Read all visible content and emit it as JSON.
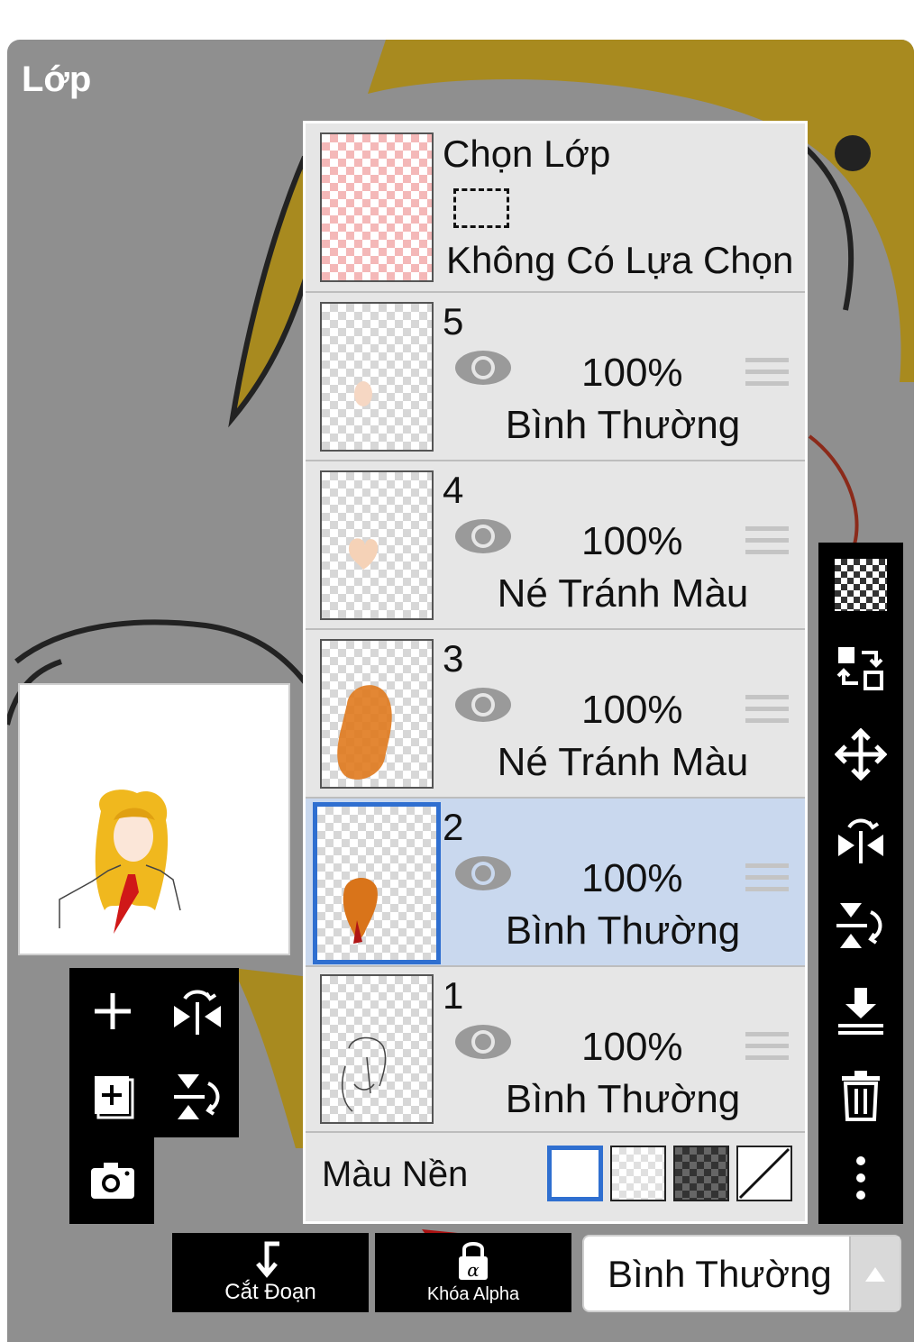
{
  "panel": {
    "title": "Lớp"
  },
  "selection_layer": {
    "name": "Chọn Lớp",
    "status": "Không Có Lựa Chọn"
  },
  "layers": [
    {
      "name": "5",
      "opacity": "100%",
      "blend": "Bình Thường",
      "selected": false
    },
    {
      "name": "4",
      "opacity": "100%",
      "blend": "Né Tránh Màu",
      "selected": false
    },
    {
      "name": "3",
      "opacity": "100%",
      "blend": "Né Tránh Màu",
      "selected": false
    },
    {
      "name": "2",
      "opacity": "100%",
      "blend": "Bình Thường",
      "selected": true
    },
    {
      "name": "1",
      "opacity": "100%",
      "blend": "Bình Thường",
      "selected": false
    }
  ],
  "background": {
    "label": "Màu Nền",
    "options": [
      "white",
      "transparent-light",
      "transparent-dark",
      "none"
    ],
    "selected": "white"
  },
  "right_toolbar": [
    "transparent-checker-icon",
    "swap-layer-icon",
    "move-icon",
    "flip-horizontal-icon",
    "flip-vertical-icon",
    "merge-down-icon",
    "trash-icon",
    "more-vertical-icon"
  ],
  "left_toolbar": [
    "add-layer-icon",
    "flip-horizontal-icon",
    "add-copy-layer-icon",
    "flip-vertical-icon",
    "camera-icon"
  ],
  "bottom": {
    "clip_label": "Cắt Đoạn",
    "alpha_lock_label": "Khóa Alpha",
    "blend_mode": "Bình Thường"
  },
  "colors": {
    "accent": "#2f6fd0",
    "selected_row": "#c9d8ee",
    "panel_bg": "#8f8f8f"
  }
}
